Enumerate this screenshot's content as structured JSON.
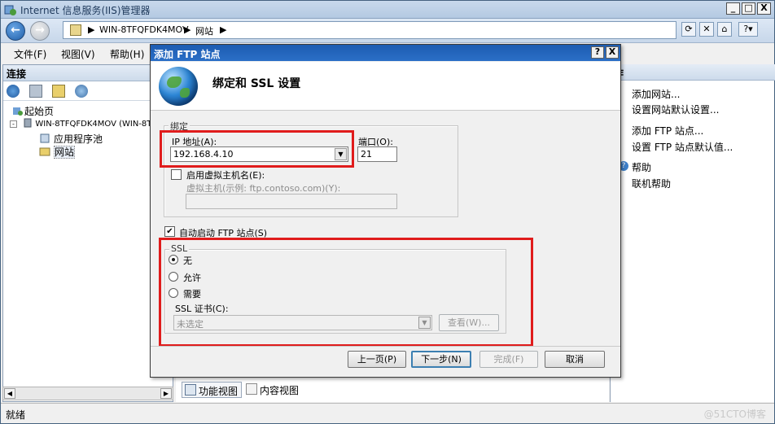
{
  "window": {
    "title": "Internet 信息服务(IIS)管理器",
    "controls": [
      "_",
      "□",
      "X"
    ]
  },
  "address": {
    "crumbs": [
      "WIN-8TFQFDK4MOV",
      "网站"
    ],
    "arrow": "▶"
  },
  "menu": [
    "文件(F)",
    "视图(V)",
    "帮助(H)"
  ],
  "connections": {
    "header": "连接",
    "tree": [
      {
        "label": "起始页",
        "icon": "start-page-icon"
      },
      {
        "label": "WIN-8TFQFDK4MOV (WIN-8T",
        "icon": "server-icon"
      },
      {
        "label": "应用程序池",
        "icon": "app-pool-icon"
      },
      {
        "label": "网站",
        "icon": "sites-folder-icon"
      }
    ]
  },
  "actions": {
    "header": "作",
    "items": [
      "添加网站...",
      "设置网站默认设置...",
      "添加 FTP 站点...",
      "设置 FTP 站点默认值...",
      "帮助",
      "联机帮助"
    ]
  },
  "view_tabs": [
    "功能视图",
    "内容视图"
  ],
  "status": {
    "text": "就绪",
    "watermark": "@51CTO博客"
  },
  "dialog": {
    "title": "添加 FTP 站点",
    "help_btn": "?",
    "close_btn": "X",
    "heading": "绑定和 SSL 设置",
    "binding": {
      "group_label": "绑定",
      "ip_label": "IP 地址(A):",
      "ip_value": "192.168.4.10",
      "port_label": "端口(O):",
      "port_value": "21",
      "vhost_check_label": "启用虚拟主机名(E):",
      "vhost_check": false,
      "vhost_label": "虚拟主机(示例: ftp.contoso.com)(Y):",
      "vhost_value": ""
    },
    "autostart": {
      "label": "自动启动 FTP 站点(S)",
      "checked": true
    },
    "ssl": {
      "group_label": "SSL",
      "options": [
        "无",
        "允许",
        "需要"
      ],
      "selected": "无",
      "cert_label": "SSL 证书(C):",
      "cert_value": "未选定",
      "view_button": "查看(W)..."
    },
    "buttons": {
      "prev": "上一页(P)",
      "next": "下一步(N)",
      "finish": "完成(F)",
      "cancel": "取消"
    }
  },
  "colors": {
    "highlight_box": "#e01c1c",
    "title_blue": "#1c5bb1"
  }
}
